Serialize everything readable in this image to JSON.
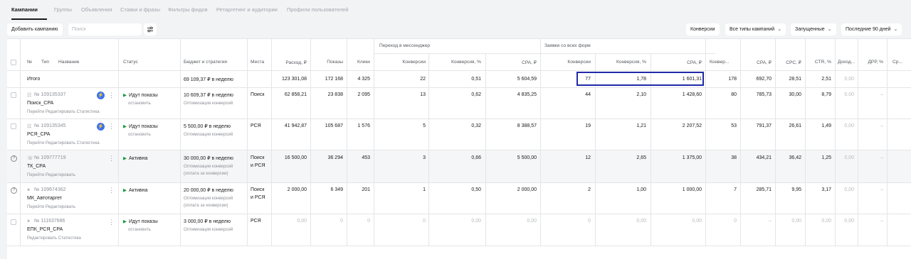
{
  "tabs": [
    "Кампании",
    "Группы",
    "Объявления",
    "Ставки и фразы",
    "Фильтры фидов",
    "Ретаргетинг и аудитории",
    "Профили пользователей"
  ],
  "toolbar": {
    "add_campaign": "Добавить кампанию",
    "search_placeholder": "Поиск",
    "conversions": "Конверсии",
    "campaign_types": "Все типы кампаний",
    "status_filter": "Запущенные",
    "period": "Последние 90 дней"
  },
  "group_headers": {
    "messenger": "Переход в мессенджер",
    "forms": "Заявки со всех форм"
  },
  "columns": {
    "num": "№",
    "type": "Тип",
    "name": "Название",
    "status": "Статус",
    "budget": "Бюджет и стратегия",
    "places": "Места",
    "spend": "Расход, ₽",
    "impressions": "Показы",
    "clicks": "Клики",
    "m_conv": "Конверсии",
    "m_conv_pct": "Конверсия, %",
    "m_cpa": "CPA, ₽",
    "f_conv": "Конверсии",
    "f_conv_pct": "Конверсия, %",
    "f_cpa": "CPA, ₽",
    "conv": "Конвер...",
    "cpa": "CPA, ₽",
    "cpc": "CPC, ₽",
    "ctr": "CTR, %",
    "income": "Доход...",
    "drr": "ДРР, %",
    "more": "Ср..."
  },
  "total": {
    "label": "Итого",
    "budget": "69 109,37 ₽ в неделю",
    "spend": "123 301,08",
    "impressions": "172 168",
    "clicks": "4 325",
    "m_conv": "22",
    "m_conv_pct": "0,51",
    "m_cpa": "5 604,59",
    "f_conv": "77",
    "f_conv_pct": "1,78",
    "f_cpa": "1 601,31",
    "conv": "178",
    "cpa": "692,70",
    "cpc": "28,51",
    "ctr": "2,51",
    "income": "0,00"
  },
  "rows": [
    {
      "id": "№ 109135337",
      "name": "Поиск_CPA",
      "links": "Перейти  Редактировать  Статистика",
      "status": "Идут показы",
      "status_sub": "остановить",
      "budget": "10 609,37 ₽ в неделю",
      "strategy": "Оптимизация конверсий",
      "strategy2": "",
      "places": "Поиск",
      "places2": "",
      "spend": "62 858,21",
      "impressions": "23 838",
      "clicks": "2 095",
      "m_conv": "13",
      "m_conv_pct": "0,62",
      "m_cpa": "4 835,25",
      "f_conv": "44",
      "f_conv_pct": "2,10",
      "f_cpa": "1 428,60",
      "conv": "80",
      "cpa": "785,73",
      "cpc": "30,00",
      "ctr": "8,79",
      "income": "0,00",
      "drr": "–"
    },
    {
      "id": "№ 109135345",
      "name": "РСЯ_CPA",
      "links": "Перейти  Редактировать  Статистика",
      "status": "Идут показы",
      "status_sub": "остановить",
      "budget": "5 500,00 ₽ в неделю",
      "strategy": "Оптимизация конверсий",
      "strategy2": "",
      "places": "РСЯ",
      "places2": "",
      "spend": "41 942,87",
      "impressions": "105 687",
      "clicks": "1 576",
      "m_conv": "5",
      "m_conv_pct": "0,32",
      "m_cpa": "8 388,57",
      "f_conv": "19",
      "f_conv_pct": "1,21",
      "f_cpa": "2 207,52",
      "conv": "53",
      "cpa": "791,37",
      "cpc": "26,61",
      "ctr": "1,49",
      "income": "0,00",
      "drr": "–"
    },
    {
      "id": "№ 109777719",
      "name": "ТК_CPA",
      "links": "Перейти  Редактировать",
      "status": "Активна",
      "status_sub": "",
      "budget": "30 000,00 ₽ в неделю",
      "strategy": "Оптимизация конверсий",
      "strategy2": "(оплата за конверсии)",
      "places": "Поиск",
      "places2": "и РСЯ",
      "spend": "16 500,00",
      "impressions": "36 294",
      "clicks": "453",
      "m_conv": "3",
      "m_conv_pct": "0,66",
      "m_cpa": "5 500,00",
      "f_conv": "12",
      "f_conv_pct": "2,65",
      "f_cpa": "1 375,00",
      "conv": "38",
      "cpa": "434,21",
      "cpc": "36,42",
      "ctr": "1,25",
      "income": "0,00",
      "drr": "–"
    },
    {
      "id": "№ 109674362",
      "name": "МК_Автотаргет",
      "links": "Перейти  Редактировать",
      "status": "Активна",
      "status_sub": "",
      "budget": "20 000,00 ₽ в неделю",
      "strategy": "Оптимизация конверсий",
      "strategy2": "(оплата за конверсии)",
      "places": "Поиск",
      "places2": "и РСЯ",
      "spend": "2 000,00",
      "impressions": "6 349",
      "clicks": "201",
      "m_conv": "1",
      "m_conv_pct": "0,50",
      "m_cpa": "2 000,00",
      "f_conv": "2",
      "f_conv_pct": "1,00",
      "f_cpa": "1 000,00",
      "conv": "7",
      "cpa": "285,71",
      "cpc": "9,95",
      "ctr": "3,17",
      "income": "0,00",
      "drr": "–"
    },
    {
      "id": "№ 111637686",
      "name": "ЕПК_РСЯ_CPA",
      "links": "Редактировать  Статистика",
      "status": "Идут показы",
      "status_sub": "остановить",
      "budget": "3 000,00 ₽ в неделю",
      "strategy": "Оптимизация конверсий",
      "strategy2": "",
      "places": "РСЯ",
      "places2": "",
      "spend": "0,00",
      "impressions": "0",
      "clicks": "0",
      "m_conv": "0",
      "m_conv_pct": "0,00",
      "m_cpa": "0,00",
      "f_conv": "0",
      "f_conv_pct": "0,00",
      "f_cpa": "0,00",
      "conv": "0",
      "cpa": "–",
      "cpc": "0,00",
      "ctr": "0,00",
      "income": "0,00",
      "drr": "–"
    }
  ]
}
